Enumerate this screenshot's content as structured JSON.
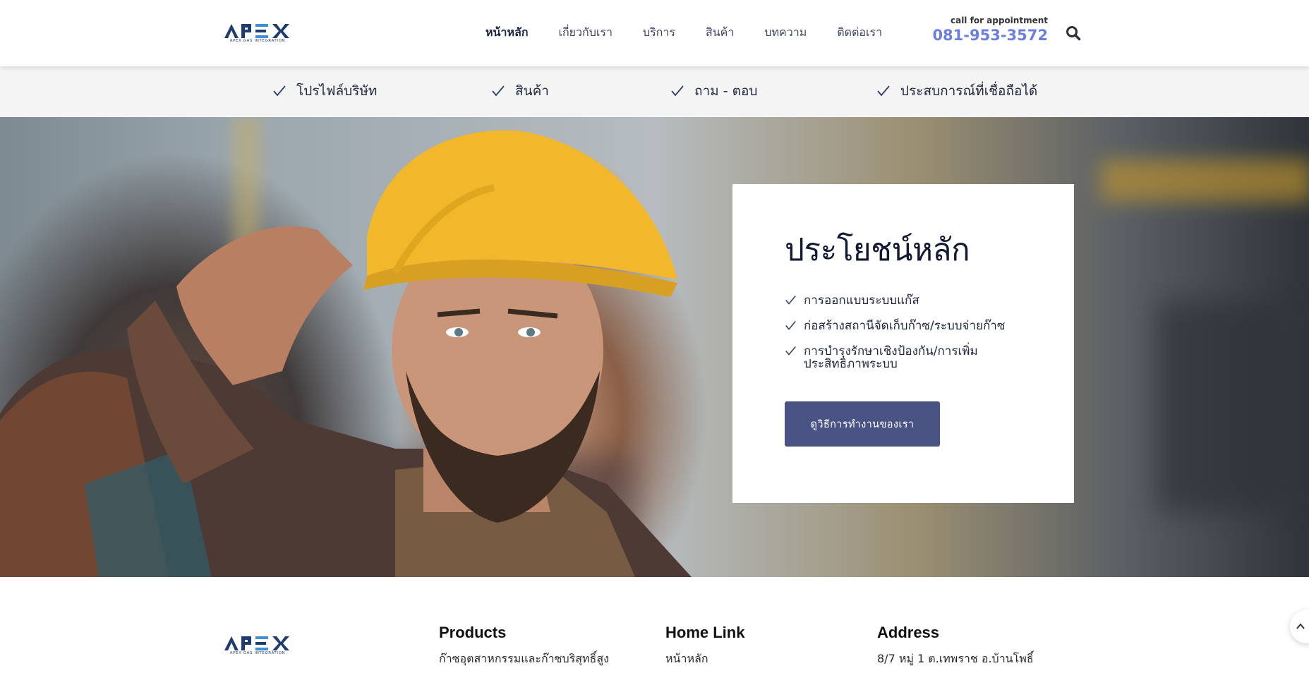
{
  "header": {
    "logo_subtitle": "APEX GAS INTEGRATION",
    "nav": [
      "หน้าหลัก",
      "เกี่ยวกับเรา",
      "บริการ",
      "สินค้า",
      "บทความ",
      "ติดต่อเรา"
    ],
    "appointment_label": "call for appointment",
    "appointment_phone": "081-953-3572",
    "search_icon": "search-icon"
  },
  "strip": {
    "items": [
      "โปรไฟล์บริษัท",
      "สินค้า",
      "ถาม - ตอบ",
      "ประสบการณ์ที่เชื่อถือได้"
    ]
  },
  "hero": {
    "image_alt_icon": "construction-worker-photo",
    "card": {
      "title": "ประโยชน์หลัก",
      "items": [
        "การออกแบบระบบแก๊ส",
        "ก่อสร้างสถานีจัดเก็บก๊าซ/ระบบจ่ายก๊าซ",
        "การบำรุงรักษาเชิงป้องกัน/การเพิ่มประสิทธิภาพระบบ"
      ],
      "button_label": "ดูวิธีการทำงานของเรา"
    }
  },
  "footer": {
    "columns": [
      {
        "title": "Products",
        "lines": [
          "ก๊าซอุตสาหกรรมและก๊าซบริสุทธิ์สูง"
        ]
      },
      {
        "title": "Home Link",
        "lines": [
          "หน้าหลัก"
        ]
      },
      {
        "title": "Address",
        "lines": [
          "8/7 หมู่ 1 ต.เทพราช อ.บ้านโพธิ์"
        ]
      }
    ]
  },
  "colors": {
    "accent_phone": "#6b7fe0",
    "button_bg": "#4a5484",
    "navy": "#1e2640"
  }
}
